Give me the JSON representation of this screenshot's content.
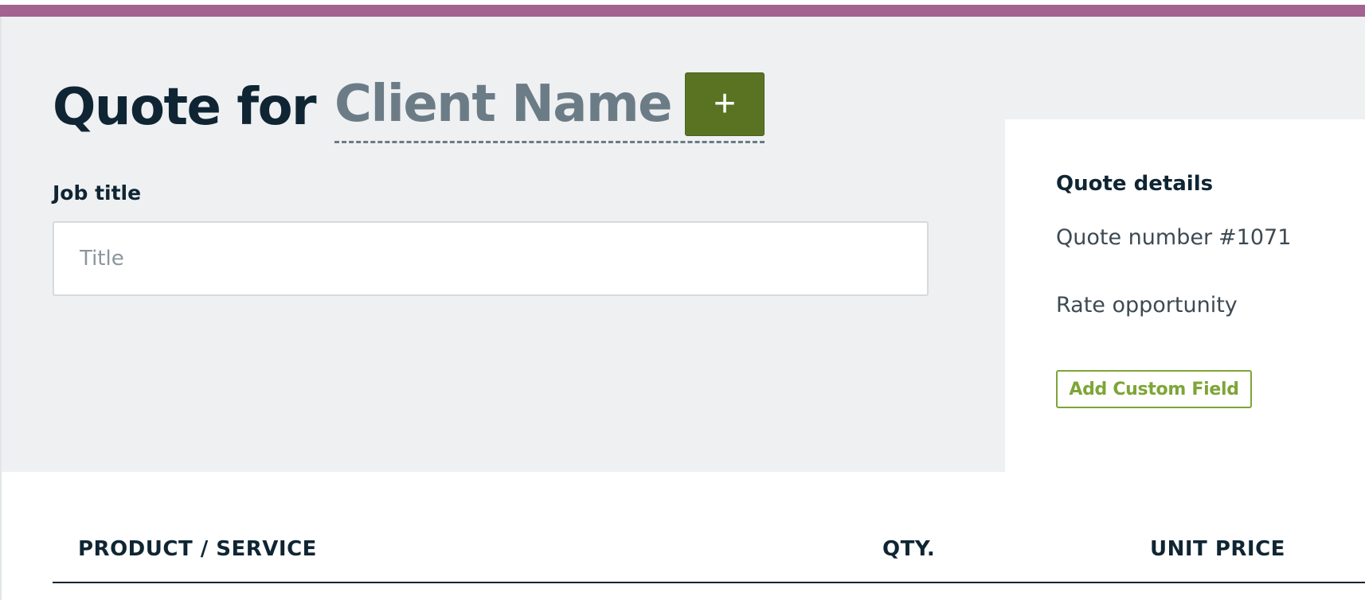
{
  "header": {
    "title_prefix": "Quote for",
    "client_name_placeholder": "Client Name",
    "add_client_label": "+"
  },
  "job": {
    "label": "Job title",
    "input_value": "",
    "input_placeholder": "Title"
  },
  "details": {
    "heading": "Quote details",
    "quote_number_label": "Quote number",
    "quote_number_value": "#1071",
    "rate_opportunity_label": "Rate opportunity",
    "add_custom_field_label": "Add Custom Field"
  },
  "line_items": {
    "columns": [
      "PRODUCT / SERVICE",
      "QTY.",
      "UNIT PRICE"
    ]
  },
  "colors": {
    "accent_bar": "#a3628f",
    "primary_green": "#5a7323",
    "secondary_green": "#7da537",
    "header_background": "#eef0f2",
    "text_dark": "#0f2533",
    "text_muted": "#6c7c87"
  }
}
